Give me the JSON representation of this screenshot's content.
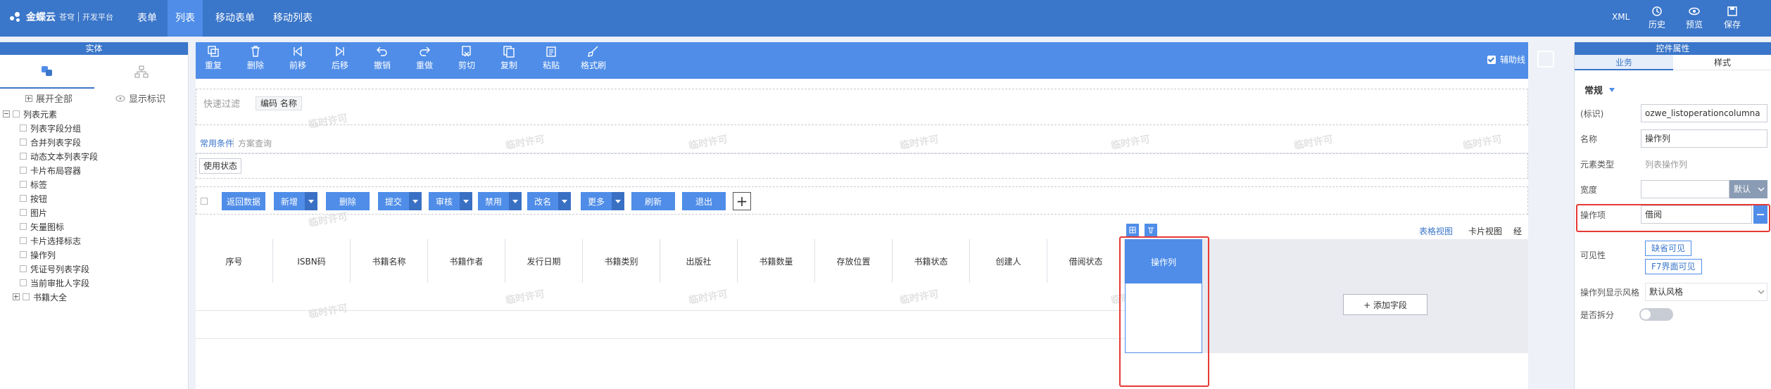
{
  "topbar": {
    "brand_name": "金蝶云",
    "brand_sub": "苍穹",
    "platform": "开发平台",
    "tabs": [
      "表单",
      "列表",
      "移动表单",
      "移动列表"
    ],
    "active_tab": "列表",
    "xml": "XML",
    "history": "历史",
    "preview": "预览",
    "save": "保存"
  },
  "left": {
    "title": "实体",
    "expand_all": "展开全部",
    "show_identifier": "显示标识",
    "root": "列表元素",
    "items": [
      "列表字段分组",
      "合并列表字段",
      "动态文本列表字段",
      "卡片布局容器",
      "标签",
      "按钮",
      "图片",
      "矢量图标",
      "卡片选择标志",
      "操作列",
      "凭证号列表字段",
      "当前审批人字段"
    ],
    "collapsed": "书籍大全"
  },
  "toolbar": {
    "buttons": [
      "重复",
      "删除",
      "前移",
      "后移",
      "撤销",
      "重做",
      "剪切",
      "复制",
      "粘贴",
      "格式刷"
    ],
    "aux_line": "辅助线"
  },
  "canvas": {
    "quick_filter": "快速过滤",
    "filter_tag": "编码  名称",
    "common_cond": "常用条件",
    "scheme_query": "方案查询",
    "status_btn": "使用状态",
    "action_buttons": [
      {
        "label": "返回数据",
        "dropdown": false
      },
      {
        "label": "新增",
        "dropdown": true
      },
      {
        "label": "删除",
        "dropdown": false
      },
      {
        "label": "提交",
        "dropdown": true
      },
      {
        "label": "审核",
        "dropdown": true
      },
      {
        "label": "禁用",
        "dropdown": true
      },
      {
        "label": "改名",
        "dropdown": true
      },
      {
        "label": "更多",
        "dropdown": true
      },
      {
        "label": "刷新",
        "dropdown": false
      },
      {
        "label": "退出",
        "dropdown": false
      }
    ],
    "views": [
      "表格视图",
      "卡片视图",
      "经分析视图"
    ],
    "columns": [
      "序号",
      "ISBN码",
      "书籍名称",
      "书籍作者",
      "发行日期",
      "书籍类别",
      "出版社",
      "书籍数量",
      "存放位置",
      "书籍状态",
      "创建人",
      "借阅状态"
    ],
    "op_column": "操作列",
    "add_field": "+ 添加字段",
    "watermark": "临时许可"
  },
  "right": {
    "title": "控件属性",
    "tabs": [
      "业务",
      "样式"
    ],
    "group": "常规",
    "identifier_label": "(标识)",
    "identifier_value": "ozwe_listoperationcolumna",
    "name_label": "名称",
    "name_value": "操作列",
    "type_label": "元素类型",
    "type_value": "列表操作列",
    "width_label": "宽度",
    "width_default": "默认",
    "ops_label": "操作项",
    "ops_value": "借阅",
    "visible_label": "可见性",
    "visible_default": "缺省可见",
    "visible_f7": "F7界面可见",
    "style_label": "操作列显示风格",
    "style_value": "默认风格",
    "split_label": "是否拆分"
  },
  "colors": {
    "primary": "#3a76c9",
    "toolbar": "#4f8de8",
    "highlight": "#e53935"
  }
}
